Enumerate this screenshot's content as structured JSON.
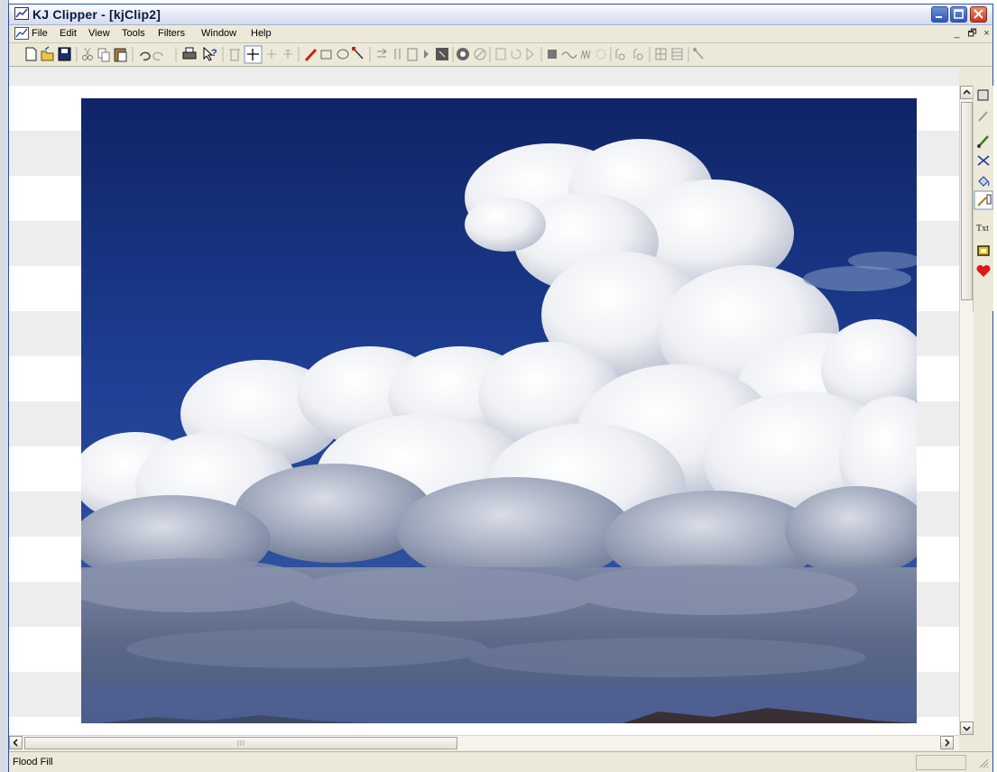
{
  "window": {
    "title": "KJ Clipper - [kjClip2]",
    "accent": "#2b4fa8"
  },
  "title_icon": "app-chart-icon",
  "caption_buttons": [
    "minimize-icon",
    "maximize-icon",
    "close-icon"
  ],
  "menu": {
    "items": [
      "File",
      "Edit",
      "View",
      "Tools",
      "Filters",
      "Window",
      "Help"
    ]
  },
  "mdi_buttons": {
    "minimize": "_",
    "restore": "🗗",
    "close": "×"
  },
  "toolbar": {
    "icons": [
      "new-icon",
      "open-icon",
      "save-icon",
      "cut-icon",
      "copy-icon",
      "paste-icon",
      "undo-icon",
      "redo-icon",
      "print-icon",
      "help-cursor-icon",
      "delete-icon",
      "move-icon",
      "align-icon",
      "align-center-icon",
      "pencil-icon",
      "rectangle-icon",
      "ellipse-icon",
      "line-icon",
      "flip-horizontal-icon",
      "flip-vertical-icon",
      "page-icon",
      "arrow-icon",
      "crop-icon",
      "circle-icon",
      "no-icon",
      "frame-icon",
      "rotate-icon",
      "forward-icon",
      "fill-square-icon",
      "wave-icon",
      "noise-icon",
      "blur-icon",
      "sharpen-icon",
      "contrast-icon",
      "grid-icon",
      "grid2-icon",
      "magic-icon"
    ]
  },
  "palette": {
    "icons": [
      "select-icon",
      "eyedropper-icon",
      "brush-icon",
      "scissors-icon",
      "flood-fill-icon",
      "draw-icon",
      "text-icon",
      "frame-icon",
      "heart-icon"
    ],
    "text_tool_label": "Txt"
  },
  "canvas": {
    "image": "cumulus-clouds-blue-sky-photo"
  },
  "status": {
    "text": "Flood Fill"
  }
}
